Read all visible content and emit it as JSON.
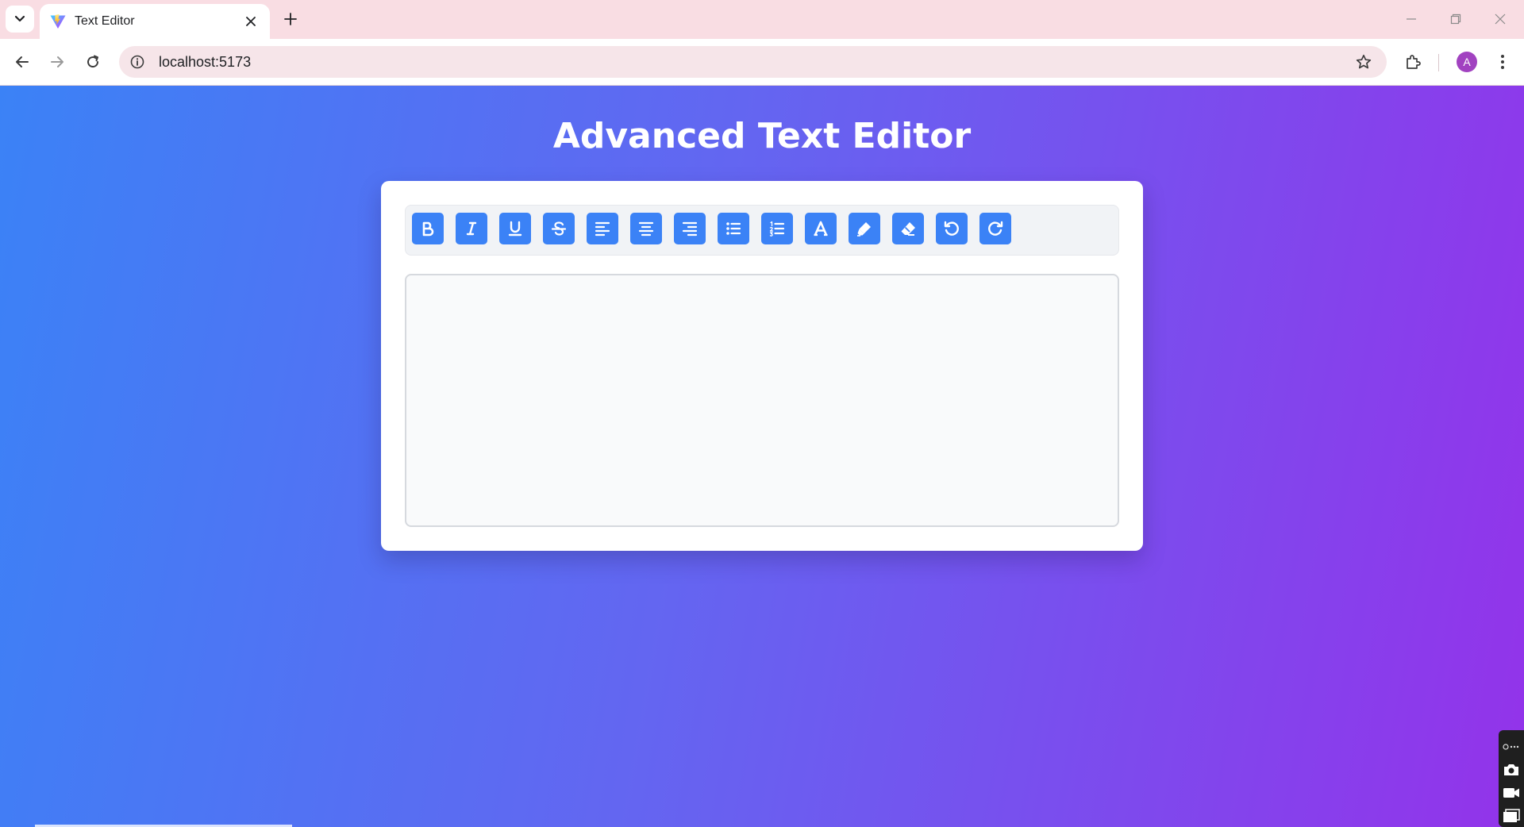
{
  "browser": {
    "tab_title": "Text Editor",
    "url": "localhost:5173",
    "profile_initial": "A"
  },
  "page": {
    "title": "Advanced Text Editor"
  },
  "toolbar": {
    "buttons": [
      {
        "name": "bold",
        "icon": "bold-icon"
      },
      {
        "name": "italic",
        "icon": "italic-icon"
      },
      {
        "name": "underline",
        "icon": "underline-icon"
      },
      {
        "name": "strikethrough",
        "icon": "strikethrough-icon"
      },
      {
        "name": "align-left",
        "icon": "align-left-icon"
      },
      {
        "name": "align-center",
        "icon": "align-center-icon"
      },
      {
        "name": "align-right",
        "icon": "align-right-icon"
      },
      {
        "name": "bullet-list",
        "icon": "bullet-list-icon"
      },
      {
        "name": "numbered-list",
        "icon": "numbered-list-icon"
      },
      {
        "name": "text-color",
        "icon": "font-icon"
      },
      {
        "name": "highlight",
        "icon": "highlighter-icon"
      },
      {
        "name": "clear-format",
        "icon": "eraser-icon"
      },
      {
        "name": "undo",
        "icon": "undo-icon"
      },
      {
        "name": "redo",
        "icon": "redo-icon"
      }
    ]
  },
  "editor": {
    "content": ""
  },
  "colors": {
    "button": "#3b82f6",
    "gradient_start": "#3b82f6",
    "gradient_end": "#9333ea"
  }
}
